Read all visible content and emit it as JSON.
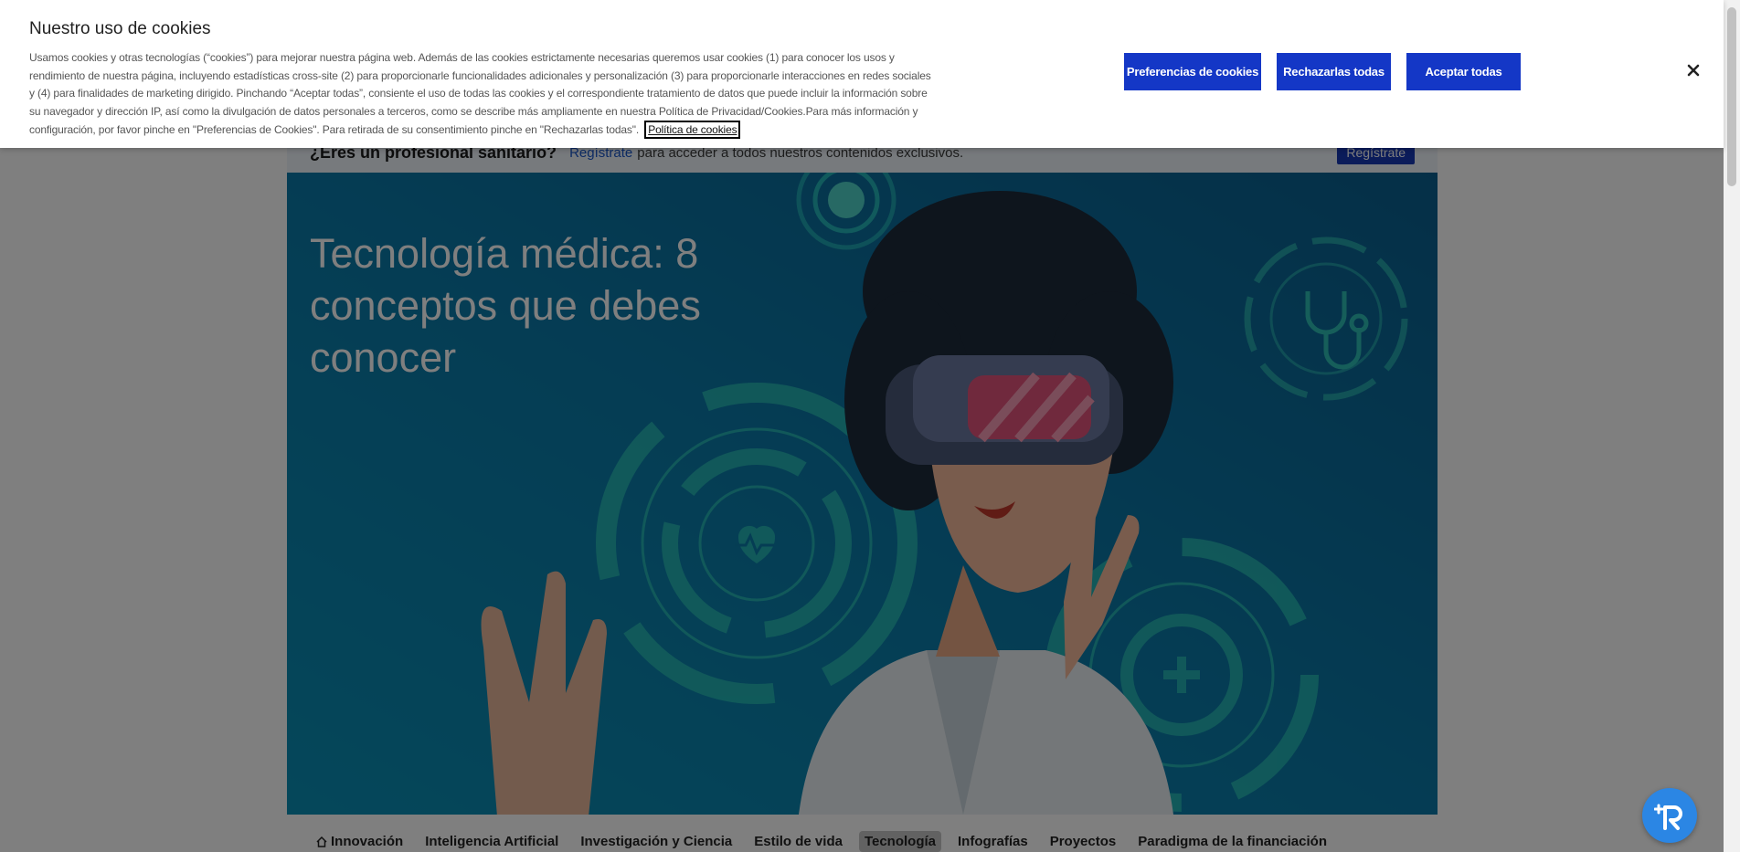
{
  "banner": {
    "title": "Nuestro uso de cookies",
    "description": "Usamos cookies y otras tecnologías (“cookies”) para mejorar nuestra página web. Además de las cookies estrictamente necesarias queremos usar cookies (1) para conocer los usos y rendimiento de nuestra página, incluyendo estadísticas cross-site (2) para proporcionarle funcionalidades adicionales y personalización (3) para proporcionarle interacciones en redes sociales y (4) para finalidades de marketing dirigido. Pinchando “Aceptar todas”, consiente el uso de todas las cookies y el correspondiente tratamiento de datos que puede incluir la información sobre su navegador y dirección IP, así como la divulgación de datos personales a terceros, como se describe más ampliamente en nuestra Política de Privacidad/Cookies.Para más información y configuración, por favor pinche en \"Preferencias de Cookies\". Para retirada de su consentimiento pinche en \"Rechazarlas todas\".",
    "policy_link": "Política de cookies",
    "preferences_label": "Preferencias de cookies",
    "reject_label": "Rechazarlas todas",
    "accept_label": "Aceptar todas",
    "accent_color": "#1437c6"
  },
  "pro_bar": {
    "question": "¿Eres un profesional sanitario?",
    "link": "Regístrate",
    "text": "para acceder a todos nuestros contenidos exclusivos.",
    "button": "Regístrate"
  },
  "hero": {
    "title": "Tecnología médica: 8 conceptos que debes conocer"
  },
  "nav": {
    "items": [
      {
        "label": "Innovación",
        "icon": "home-icon"
      },
      {
        "label": "Inteligencia Artificial"
      },
      {
        "label": "Investigación y Ciencia"
      },
      {
        "label": "Estilo de vida"
      },
      {
        "label": "Tecnología",
        "active": true
      },
      {
        "label": "Infografías"
      },
      {
        "label": "Proyectos"
      },
      {
        "label": "Paradigma de la financiación"
      }
    ]
  },
  "icons": {
    "close": "close-icon",
    "assistant": "assistant-icon",
    "stethoscope": "stethoscope-icon",
    "heart": "heart-pulse-icon",
    "plus": "medical-cross-icon"
  }
}
